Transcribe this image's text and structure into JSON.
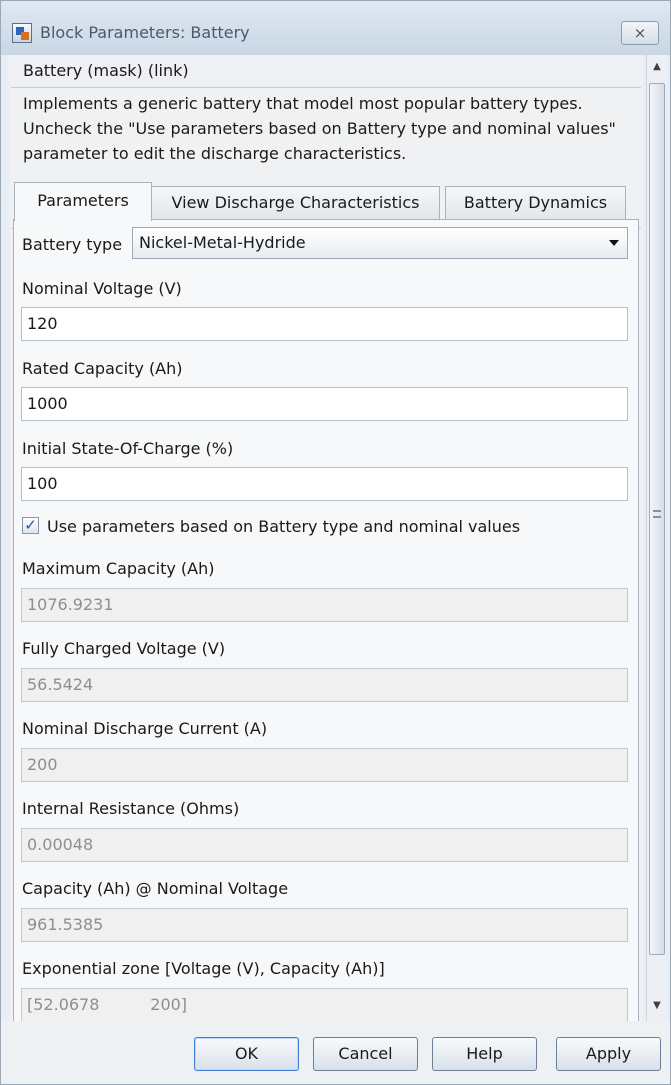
{
  "window": {
    "title": "Block Parameters: Battery",
    "close_glyph": "⨯"
  },
  "header": {
    "mask_title": "Battery (mask) (link)",
    "description": "Implements a generic battery that model most popular battery types. Uncheck the \"Use parameters based on Battery type and nominal values\" parameter to edit the discharge characteristics."
  },
  "tabs": [
    {
      "label": "Parameters",
      "active": true
    },
    {
      "label": "View Discharge Characteristics",
      "active": false
    },
    {
      "label": "Battery Dynamics",
      "active": false
    }
  ],
  "form": {
    "battery_type_label": "Battery type",
    "battery_type_value": "Nickel-Metal-Hydride",
    "nominal_voltage_label": "Nominal Voltage (V)",
    "nominal_voltage_value": "120",
    "rated_capacity_label": "Rated Capacity (Ah)",
    "rated_capacity_value": "1000",
    "initial_soc_label": "Initial State-Of-Charge (%)",
    "initial_soc_value": "100",
    "use_params_label": "Use parameters based on Battery type and nominal values",
    "use_params_checked": "✓",
    "max_capacity_label": "Maximum Capacity (Ah)",
    "max_capacity_value": "1076.9231",
    "fully_charged_voltage_label": "Fully Charged Voltage (V)",
    "fully_charged_voltage_value": "56.5424",
    "nominal_discharge_current_label": "Nominal Discharge Current (A)",
    "nominal_discharge_current_value": "200",
    "internal_resistance_label": "Internal Resistance (Ohms)",
    "internal_resistance_value": "0.00048",
    "capacity_at_nominal_voltage_label": "Capacity (Ah) @ Nominal Voltage",
    "capacity_at_nominal_voltage_value": "961.5385",
    "exponential_zone_label": "Exponential zone [Voltage (V), Capacity (Ah)]",
    "exponential_zone_value": "[52.0678          200]"
  },
  "buttons": {
    "ok": "OK",
    "cancel": "Cancel",
    "help": "Help",
    "apply": "Apply"
  },
  "colors": {
    "accent": "#3c7fd4",
    "window_bg": "#e9eef4"
  }
}
